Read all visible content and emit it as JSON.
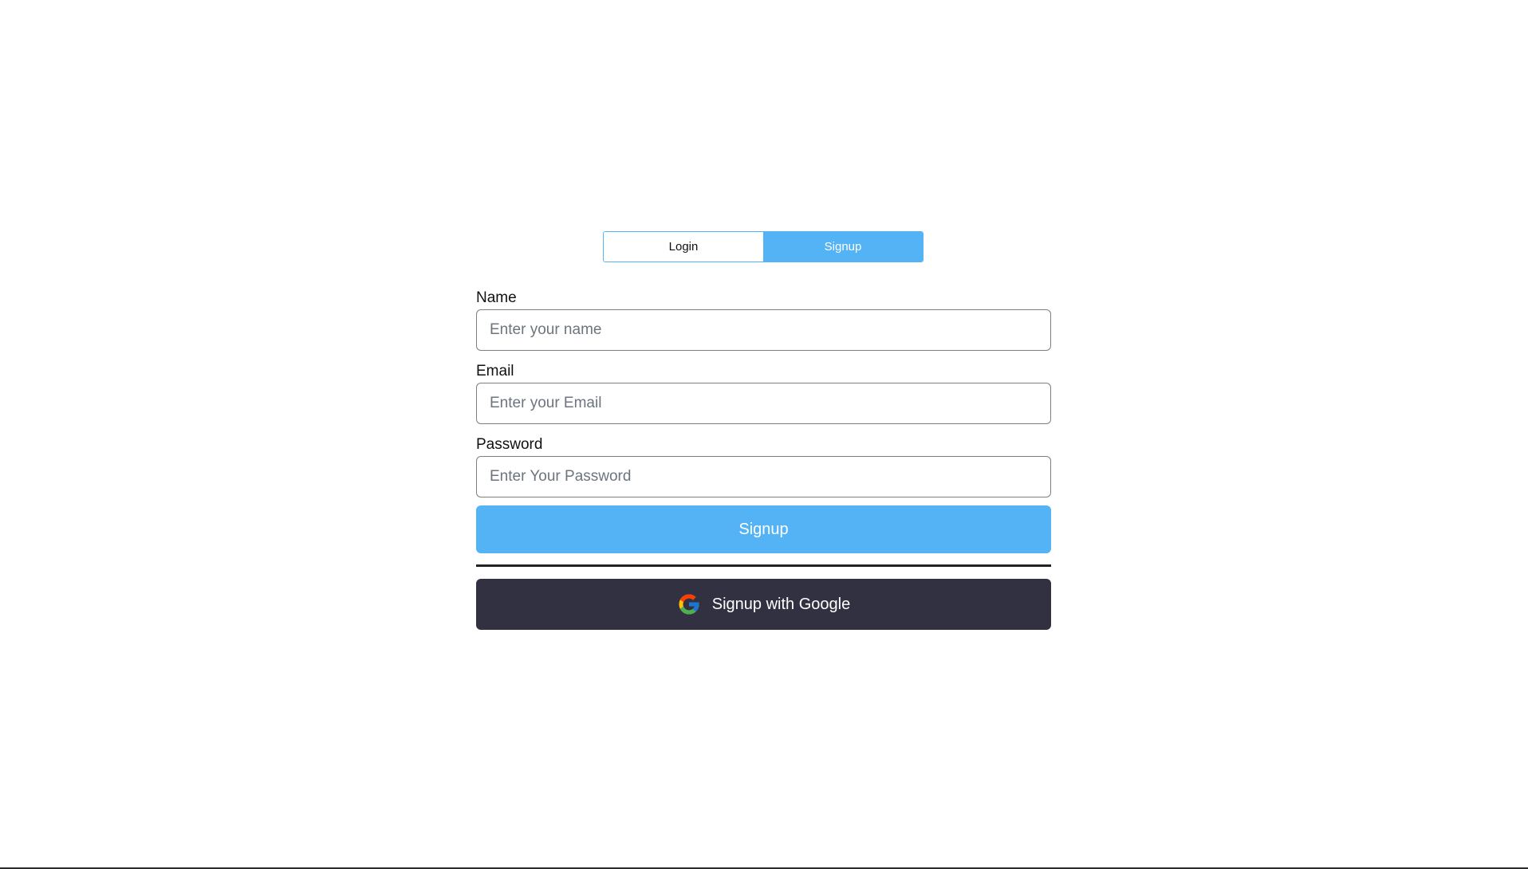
{
  "tabs": {
    "login_label": "Login",
    "signup_label": "Signup",
    "active": "signup"
  },
  "form": {
    "name": {
      "label": "Name",
      "placeholder": "Enter your name",
      "value": ""
    },
    "email": {
      "label": "Email",
      "placeholder": "Enter your Email",
      "value": ""
    },
    "password": {
      "label": "Password",
      "placeholder": "Enter Your Password",
      "value": ""
    },
    "submit_label": "Signup",
    "google_label": "Signup with Google"
  },
  "icons": {
    "google": "google-icon"
  },
  "colors": {
    "accent": "#53b3f5",
    "dark_button": "#323142",
    "divider": "#222222"
  }
}
